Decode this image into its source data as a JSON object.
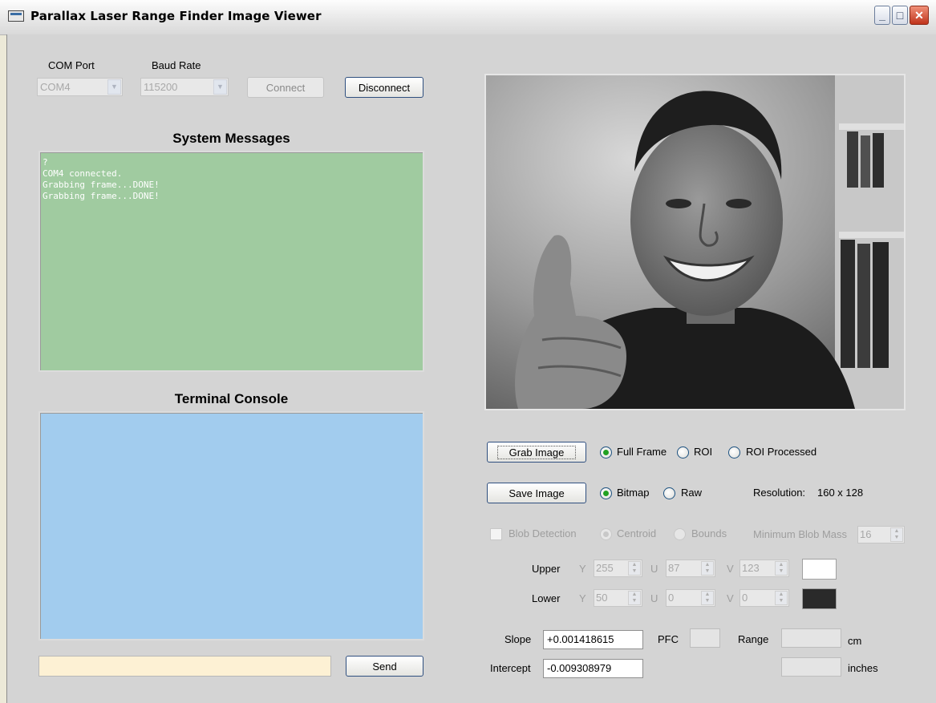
{
  "window": {
    "title": "Parallax Laser Range Finder Image Viewer",
    "buttons": {
      "minimize": "_",
      "maximize": "□",
      "close": "✕"
    }
  },
  "connection": {
    "com_port_label": "COM Port",
    "com_port_value": "COM4",
    "baud_rate_label": "Baud Rate",
    "baud_rate_value": "115200",
    "connect_label": "Connect",
    "disconnect_label": "Disconnect"
  },
  "system_messages": {
    "heading": "System Messages",
    "lines": [
      "?",
      "COM4 connected.",
      "Grabbing frame...DONE!",
      "Grabbing frame...DONE!"
    ]
  },
  "terminal": {
    "heading": "Terminal Console",
    "input_value": "",
    "send_label": "Send"
  },
  "capture": {
    "grab_label": "Grab Image",
    "modes": [
      "Full Frame",
      "ROI",
      "ROI Processed"
    ],
    "selected_mode": "Full Frame",
    "save_label": "Save Image",
    "formats": [
      "Bitmap",
      "Raw"
    ],
    "selected_format": "Bitmap",
    "resolution_label": "Resolution:",
    "resolution_value": "160 x 128"
  },
  "blob": {
    "checkbox_label": "Blob Detection",
    "centroid_label": "Centroid",
    "bounds_label": "Bounds",
    "min_mass_label": "Minimum Blob Mass",
    "min_mass_value": "16",
    "upper_label": "Upper",
    "lower_label": "Lower",
    "y_label": "Y",
    "u_label": "U",
    "v_label": "V",
    "upper": {
      "y": "255",
      "u": "87",
      "v": "123",
      "color": "#ffffff"
    },
    "lower": {
      "y": "50",
      "u": "0",
      "v": "0",
      "color": "#2a2a2a"
    }
  },
  "calibration": {
    "slope_label": "Slope",
    "slope_value": "+0.001418615",
    "intercept_label": "Intercept",
    "intercept_value": "-0.009308979",
    "pfc_label": "PFC",
    "pfc_value": "",
    "range_label": "Range",
    "range_cm_value": "",
    "cm_label": "cm",
    "range_in_value": "",
    "inches_label": "inches"
  }
}
